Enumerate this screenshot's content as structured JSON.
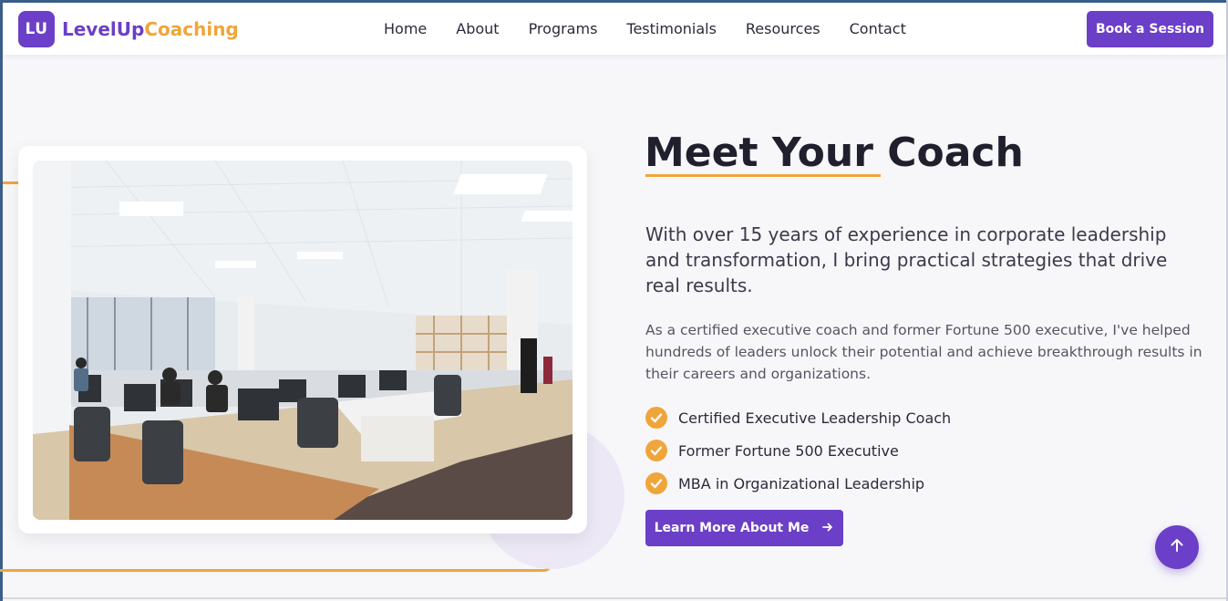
{
  "brand": {
    "badge": "LU",
    "name_part1": "LevelUp",
    "name_part2": "Coaching",
    "primary_color": "#6b3fc7",
    "accent_color": "#f0a53b"
  },
  "nav": {
    "items": [
      {
        "label": "Home"
      },
      {
        "label": "About"
      },
      {
        "label": "Programs"
      },
      {
        "label": "Testimonials"
      },
      {
        "label": "Resources"
      },
      {
        "label": "Contact"
      }
    ],
    "cta_label": "Book a Session"
  },
  "hero": {
    "title": "Meet Your Coach",
    "lead": "With over 15 years of experience in corporate leadership and transformation, I bring practical strategies that drive real results.",
    "body": "As a certified executive coach and former Fortune 500 executive, I've helped hundreds of leaders unlock their potential and achieve breakthrough results in their careers and organizations.",
    "credentials": [
      {
        "label": "Certified Executive Leadership Coach",
        "icon": "check-icon"
      },
      {
        "label": "Former Fortune 500 Executive",
        "icon": "check-icon"
      },
      {
        "label": "MBA in Organizational Leadership",
        "icon": "check-icon"
      }
    ],
    "button_label": "Learn More About Me",
    "button_icon": "arrow-right-icon",
    "image_icon": "office-photo"
  },
  "scroll_top": {
    "icon": "arrow-up-icon"
  }
}
